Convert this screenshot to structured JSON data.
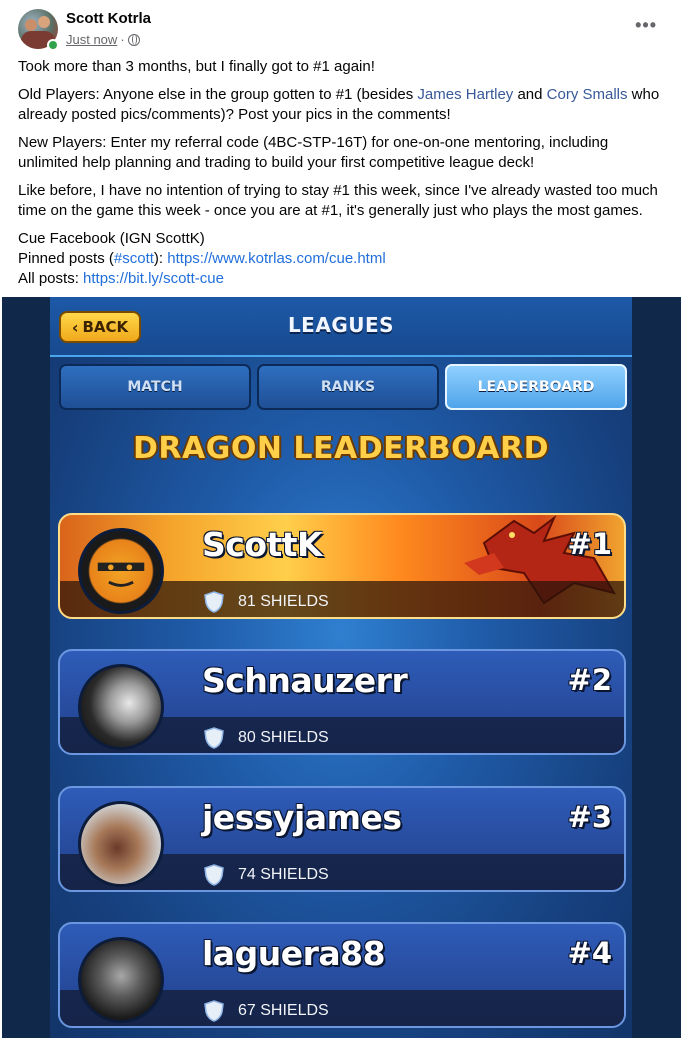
{
  "post": {
    "author": "Scott Kotrla",
    "time": "Just now",
    "dot": "·",
    "more_icon": "more-horizontal-icon",
    "privacy_icon": "globe-icon"
  },
  "content": {
    "p1": "Took more than 3 months, but I finally got to #1 again!",
    "p2_a": "Old Players: Anyone else in the group gotten to #1 (besides ",
    "p2_link1": "James Hartley",
    "p2_b": " and ",
    "p2_link2": "Cory Smalls",
    "p2_c": " who already posted pics/comments)?  Post your pics in the comments!",
    "p3": "New Players: Enter my referral code (4BC-STP-16T) for one-on-one mentoring, including unlimited help planning and trading to build your first competitive league deck!",
    "p4": "Like before, I have no intention of trying to stay #1 this week, since I've already wasted too much time on the game this week - once you are at #1, it's generally just who plays the most games.",
    "l1": "Cue Facebook (IGN   ScottK)",
    "l2_a": "Pinned posts (",
    "l2_tag": "#scott",
    "l2_b": "):   ",
    "l2_link": "https://www.kotrlas.com/cue.html",
    "l3_a": "All posts: ",
    "l3_link": "https://bit.ly/scott-cue"
  },
  "game": {
    "back_label": "BACK",
    "title": "LEAGUES",
    "tabs": [
      "MATCH",
      "RANKS",
      "LEADERBOARD"
    ],
    "active_tab": "LEADERBOARD",
    "board_title": "DRAGON LEADERBOARD",
    "entries": [
      {
        "name": "ScottK",
        "rank": "#1",
        "shields": "81 SHIELDS"
      },
      {
        "name": "Schnauzerr",
        "rank": "#2",
        "shields": "80 SHIELDS"
      },
      {
        "name": "jessyjames",
        "rank": "#3",
        "shields": "74 SHIELDS"
      },
      {
        "name": "laguera88",
        "rank": "#4",
        "shields": "67 SHIELDS"
      }
    ]
  },
  "colors": {
    "link": "#385898",
    "accent_gold": "#ffcf4a",
    "online": "#31a24c"
  }
}
